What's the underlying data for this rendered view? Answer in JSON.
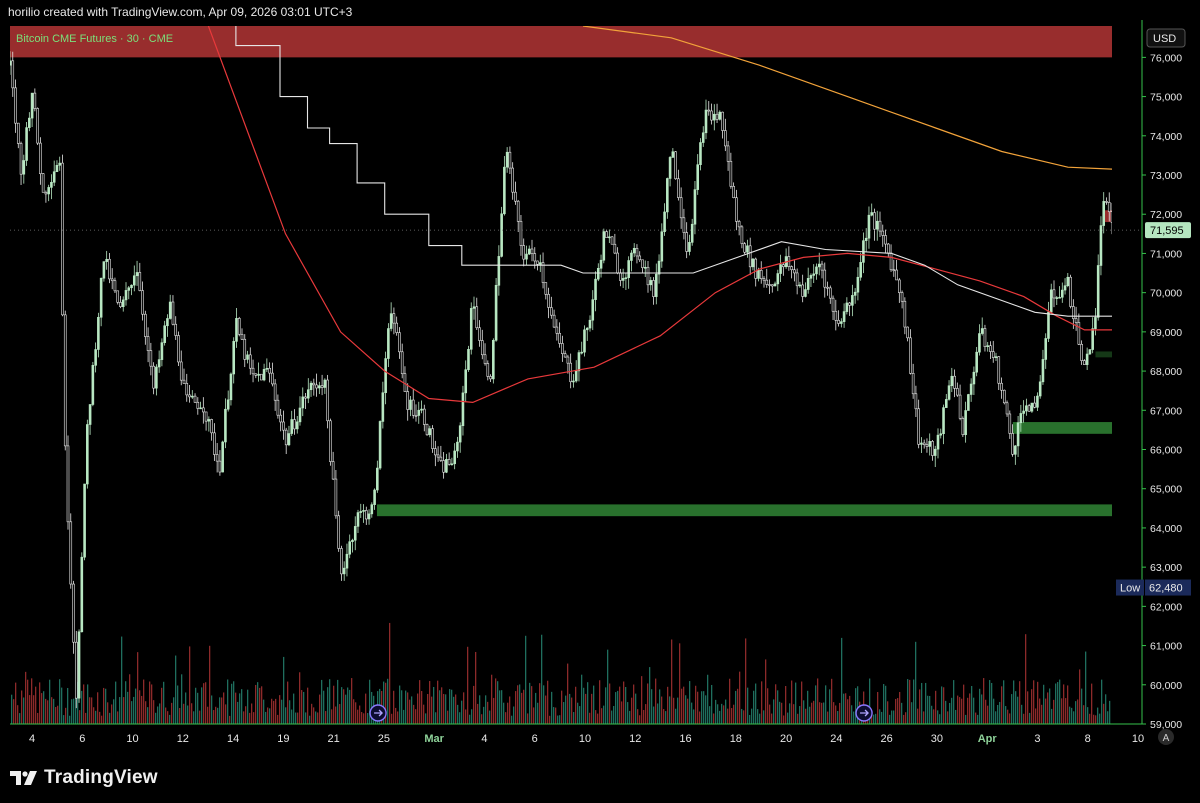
{
  "header": {
    "attribution": "horilio created with TradingView.com, Apr 09, 2026 03:01 UTC+3"
  },
  "footer": {
    "brand": "TradingView",
    "logo_icon": "tradingview-logo-icon"
  },
  "chart_data": {
    "type": "candlestick",
    "symbol_label": "Bitcoin CME Futures · 30 · CME",
    "currency": "USD",
    "ylim": [
      59000,
      76800
    ],
    "y_ticks": [
      59000,
      60000,
      61000,
      62000,
      63000,
      64000,
      65000,
      66000,
      67000,
      68000,
      69000,
      70000,
      71000,
      72000,
      73000,
      74000,
      75000,
      76000
    ],
    "y_tick_labels": [
      "59,000",
      "60,000",
      "61,000",
      "62,000",
      "63,000",
      "64,000",
      "65,000",
      "66,000",
      "67,000",
      "68,000",
      "69,000",
      "70,000",
      "71,000",
      "72,000",
      "73,000",
      "74,000",
      "75,000",
      "76,000"
    ],
    "x_ticks": [
      "4",
      "6",
      "10",
      "12",
      "14",
      "19",
      "21",
      "25",
      "Mar",
      "4",
      "6",
      "10",
      "12",
      "16",
      "18",
      "20",
      "24",
      "26",
      "30",
      "Apr",
      "3",
      "8",
      "10"
    ],
    "x_tick_highlight": [
      "Mar",
      "Apr"
    ],
    "last_price": 71595,
    "last_price_label": "71,595",
    "low": {
      "label": "Low",
      "value": 62480,
      "value_label": "62,480"
    },
    "auto_scale_label": "A",
    "colors": {
      "up": "#b9e8c3",
      "down": "#e8e8e8",
      "ma_red": "#e8393b",
      "ma_orange": "#f2a33a",
      "step_white": "#e6e6e6",
      "supply_zone": "#a83232",
      "demand_zone": "#2e7d32",
      "axis_green": "#36c24b",
      "vol_up": "#1f6e5e",
      "vol_down": "#8c2a2a"
    },
    "price_path": [
      [
        0,
        75800
      ],
      [
        0.01,
        73000
      ],
      [
        0.02,
        75200
      ],
      [
        0.03,
        72500
      ],
      [
        0.045,
        73500
      ],
      [
        0.05,
        66000
      ],
      [
        0.06,
        59700
      ],
      [
        0.07,
        66500
      ],
      [
        0.085,
        70900
      ],
      [
        0.1,
        69500
      ],
      [
        0.115,
        70700
      ],
      [
        0.13,
        67500
      ],
      [
        0.145,
        69700
      ],
      [
        0.16,
        67200
      ],
      [
        0.175,
        67200
      ],
      [
        0.19,
        65500
      ],
      [
        0.205,
        69200
      ],
      [
        0.22,
        67800
      ],
      [
        0.235,
        68000
      ],
      [
        0.25,
        66200
      ],
      [
        0.27,
        67500
      ],
      [
        0.285,
        67800
      ],
      [
        0.3,
        62800
      ],
      [
        0.315,
        64300
      ],
      [
        0.33,
        64500
      ],
      [
        0.345,
        69800
      ],
      [
        0.36,
        67200
      ],
      [
        0.375,
        66900
      ],
      [
        0.39,
        65500
      ],
      [
        0.405,
        65800
      ],
      [
        0.42,
        69800
      ],
      [
        0.435,
        67500
      ],
      [
        0.45,
        73700
      ],
      [
        0.465,
        71000
      ],
      [
        0.48,
        70900
      ],
      [
        0.495,
        68900
      ],
      [
        0.51,
        67800
      ],
      [
        0.525,
        69200
      ],
      [
        0.54,
        71600
      ],
      [
        0.555,
        70400
      ],
      [
        0.57,
        71100
      ],
      [
        0.585,
        69900
      ],
      [
        0.6,
        73800
      ],
      [
        0.615,
        71000
      ],
      [
        0.63,
        74500
      ],
      [
        0.645,
        74500
      ],
      [
        0.66,
        71700
      ],
      [
        0.675,
        70600
      ],
      [
        0.69,
        70200
      ],
      [
        0.705,
        70800
      ],
      [
        0.72,
        70000
      ],
      [
        0.735,
        70800
      ],
      [
        0.75,
        69200
      ],
      [
        0.765,
        69900
      ],
      [
        0.78,
        72000
      ],
      [
        0.795,
        71200
      ],
      [
        0.81,
        69800
      ],
      [
        0.825,
        66200
      ],
      [
        0.84,
        65900
      ],
      [
        0.855,
        68000
      ],
      [
        0.865,
        66500
      ],
      [
        0.88,
        69000
      ],
      [
        0.895,
        68200
      ],
      [
        0.91,
        66000
      ],
      [
        0.92,
        67200
      ],
      [
        0.93,
        66900
      ],
      [
        0.945,
        69900
      ],
      [
        0.96,
        70200
      ],
      [
        0.975,
        68000
      ],
      [
        0.985,
        69500
      ],
      [
        0.992,
        72500
      ],
      [
        1.0,
        71595
      ]
    ],
    "ma_red_path": [
      [
        0.18,
        76800
      ],
      [
        0.25,
        71500
      ],
      [
        0.3,
        69000
      ],
      [
        0.34,
        68000
      ],
      [
        0.38,
        67300
      ],
      [
        0.42,
        67200
      ],
      [
        0.47,
        67800
      ],
      [
        0.53,
        68100
      ],
      [
        0.59,
        68900
      ],
      [
        0.64,
        70000
      ],
      [
        0.68,
        70600
      ],
      [
        0.72,
        70900
      ],
      [
        0.76,
        71000
      ],
      [
        0.8,
        70900
      ],
      [
        0.84,
        70600
      ],
      [
        0.88,
        70300
      ],
      [
        0.92,
        69900
      ],
      [
        0.95,
        69400
      ],
      [
        0.975,
        69050
      ],
      [
        1.0,
        69050
      ]
    ],
    "ma_orange_path": [
      [
        0.52,
        76800
      ],
      [
        0.6,
        76500
      ],
      [
        0.68,
        75800
      ],
      [
        0.76,
        75000
      ],
      [
        0.84,
        74200
      ],
      [
        0.9,
        73600
      ],
      [
        0.96,
        73200
      ],
      [
        1.0,
        73150
      ]
    ],
    "step_white_path": [
      [
        0.205,
        76800
      ],
      [
        0.205,
        76300
      ],
      [
        0.245,
        76300
      ],
      [
        0.245,
        75000
      ],
      [
        0.27,
        75000
      ],
      [
        0.27,
        74200
      ],
      [
        0.29,
        74200
      ],
      [
        0.29,
        73800
      ],
      [
        0.315,
        73800
      ],
      [
        0.315,
        72800
      ],
      [
        0.34,
        72800
      ],
      [
        0.34,
        72000
      ],
      [
        0.38,
        72000
      ],
      [
        0.38,
        71200
      ],
      [
        0.41,
        71200
      ],
      [
        0.41,
        70700
      ],
      [
        0.5,
        70700
      ],
      [
        0.52,
        70500
      ],
      [
        0.62,
        70500
      ],
      [
        0.66,
        70900
      ],
      [
        0.7,
        71300
      ],
      [
        0.74,
        71100
      ],
      [
        0.8,
        71000
      ],
      [
        0.83,
        70700
      ],
      [
        0.86,
        70200
      ],
      [
        0.9,
        69800
      ],
      [
        0.93,
        69500
      ],
      [
        0.96,
        69400
      ],
      [
        1.0,
        69400
      ]
    ],
    "zones": [
      {
        "kind": "supply",
        "x_start": 0.0,
        "x_end": 1.0,
        "y_low": 76000,
        "y_high": 76800
      },
      {
        "kind": "demand",
        "x_start": 0.333,
        "x_end": 1.0,
        "y_low": 64300,
        "y_high": 64600
      },
      {
        "kind": "demand",
        "x_start": 0.91,
        "x_end": 1.0,
        "y_low": 66400,
        "y_high": 66700
      },
      {
        "kind": "demand_small",
        "x_start": 0.985,
        "x_end": 1.0,
        "y_low": 68350,
        "y_high": 68500
      },
      {
        "kind": "supply_small",
        "x_start": 0.992,
        "x_end": 1.0,
        "y_low": 71800,
        "y_high": 72100
      }
    ],
    "event_markers": [
      {
        "name": "event-marker",
        "at": 0.334,
        "icon": "forward-arrow-icon"
      },
      {
        "name": "event-marker",
        "at": 0.775,
        "icon": "forward-arrow-icon"
      }
    ]
  }
}
